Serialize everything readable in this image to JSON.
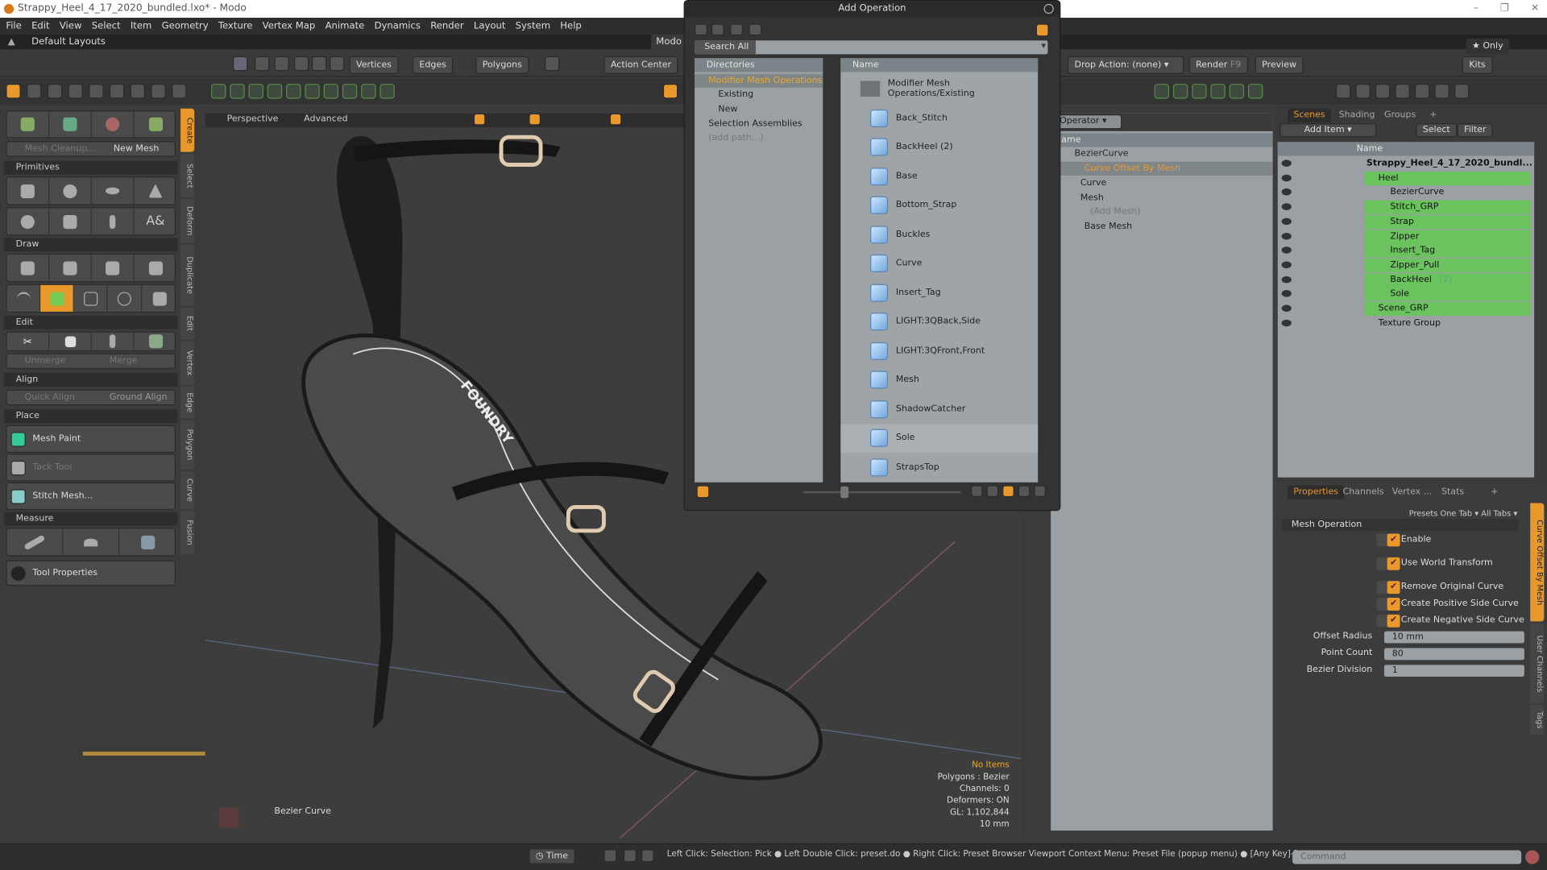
{
  "window": {
    "title": "Strappy_Heel_4_17_2020_bundled.lxo* - Modo",
    "controls": [
      "–",
      "❐",
      "✕"
    ]
  },
  "menu": [
    "File",
    "Edit",
    "View",
    "Select",
    "Item",
    "Geometry",
    "Texture",
    "Vertex Map",
    "Animate",
    "Dynamics",
    "Render",
    "Layout",
    "System",
    "Help"
  ],
  "layout_bar": {
    "label": "Default Layouts",
    "modo_tab": "Modo"
  },
  "toolbar": {
    "vertices": "Vertices",
    "edges": "Edges",
    "polygons": "Polygons",
    "action_center": "Action Center",
    "drop_action": "Drop Action: (none)",
    "render": "Render",
    "render_key": "F9",
    "preview": "Preview",
    "only": "Only",
    "kits": "Kits"
  },
  "left_panel": {
    "mesh_cleanup": "Mesh Cleanup...",
    "new_mesh": "New Mesh",
    "sections": {
      "primitives": "Primitives",
      "draw": "Draw",
      "edit": "Edit",
      "align": "Align",
      "place": "Place",
      "measure": "Measure"
    },
    "unmerge": "Unmerge",
    "merge": "Merge",
    "quick_align": "Quick Align",
    "ground_align": "Ground Align",
    "mesh_paint": "Mesh Paint",
    "tack_tool": "Tack Tool",
    "stitch_mesh": "Stitch Mesh...",
    "tool_properties": "Tool Properties",
    "vertical_tabs": [
      "Create",
      "Select",
      "Deform",
      "Duplicate",
      "Edit",
      "Vertex",
      "Edge",
      "Polygon",
      "Curve",
      "Fusion"
    ]
  },
  "viewport": {
    "view": "Perspective",
    "mode": "Advanced",
    "item_label": "Bezier Curve",
    "brand_text": "FOUNDRY",
    "hud": {
      "selection": "No Items",
      "polygons": "Polygons : Bezier",
      "channels": "Channels: 0",
      "deformers": "Deformers: ON",
      "gl": "GL: 1,102,844",
      "scale": "10 mm"
    }
  },
  "dialog": {
    "title": "Add Operation",
    "search_label": "Search All",
    "search_value": "",
    "directories_header": "Directories",
    "directories": [
      "Modifier Mesh Operations",
      "Existing",
      "New",
      "Selection Assemblies",
      "(add path...)"
    ],
    "name_header": "Name",
    "folder": "Modifier Mesh Operations/Existing",
    "items": [
      "Back_Stitch",
      "BackHeel (2)",
      "Base",
      "Bottom_Strap",
      "Buckles",
      "Curve",
      "Insert_Tag",
      "LIGHT:3QBack,Side",
      "LIGHT:3QFront,Front",
      "Mesh",
      "ShadowCatcher",
      "Sole",
      "StrapsTop"
    ]
  },
  "schematic": {
    "filter": "Operator",
    "header": "Name",
    "rows": [
      "BezierCurve",
      "Curve Offset By Mesh",
      "Curve",
      "Mesh",
      "(Add Mesh)",
      "Base Mesh"
    ]
  },
  "scenes": {
    "tabs": [
      "Scenes",
      "Shading",
      "Groups",
      "+"
    ],
    "add_item": "Add Item",
    "select": "Select",
    "filter": "Filter",
    "name_header": "Name",
    "tree": [
      {
        "label": "Strappy_Heel_4_17_2020_bundl...",
        "depth": 0,
        "selected": false,
        "bold": true
      },
      {
        "label": "Heel",
        "depth": 1,
        "selected": true
      },
      {
        "label": "BezierCurve",
        "depth": 2,
        "selected": false
      },
      {
        "label": "Stitch_GRP",
        "depth": 2,
        "selected": true
      },
      {
        "label": "Strap",
        "depth": 2,
        "selected": true
      },
      {
        "label": "Zipper",
        "depth": 2,
        "selected": true
      },
      {
        "label": "Insert_Tag",
        "depth": 2,
        "selected": true
      },
      {
        "label": "Zipper_Pull",
        "depth": 2,
        "selected": true
      },
      {
        "label": "BackHeel",
        "badge": "(2)",
        "depth": 2,
        "selected": true
      },
      {
        "label": "Sole",
        "depth": 2,
        "selected": true
      },
      {
        "label": "Scene_GRP",
        "depth": 1,
        "selected": true
      },
      {
        "label": "Texture Group",
        "depth": 1,
        "selected": false
      }
    ]
  },
  "properties": {
    "tabs": [
      "Properties",
      "Channels",
      "Vertex ...",
      "Stats",
      "+"
    ],
    "presets": "Presets",
    "one_tab": "One Tab ▾",
    "all_tabs": "All Tabs ▾",
    "section": "Mesh Operation",
    "checks": [
      {
        "label": "Enable",
        "checked": true
      },
      {
        "label": "Use World Transform",
        "checked": true
      },
      {
        "label": "Remove Original Curve",
        "checked": true
      },
      {
        "label": "Create Positive Side Curve",
        "checked": true
      },
      {
        "label": "Create Negative Side Curve",
        "checked": true
      }
    ],
    "fields": [
      {
        "label": "Offset Radius",
        "value": "10 mm"
      },
      {
        "label": "Point Count",
        "value": "80"
      },
      {
        "label": "Bezier Division",
        "value": "1"
      }
    ],
    "side_tabs": [
      "Curve Offset By Mesh",
      "User Channels",
      "Tags"
    ]
  },
  "status": {
    "time": "Time",
    "hint": "Left Click: Selection: Pick ● Left Double Click: preset.do ● Right Click: Preset Browser Viewport Context Menu: Preset File (popup menu) ● [Any Key]-[...",
    "command_placeholder": "Command"
  },
  "colors": {
    "accent": "#e9992c",
    "selection_green": "#6bc35e",
    "panel_gray": "#9aa0a3"
  }
}
